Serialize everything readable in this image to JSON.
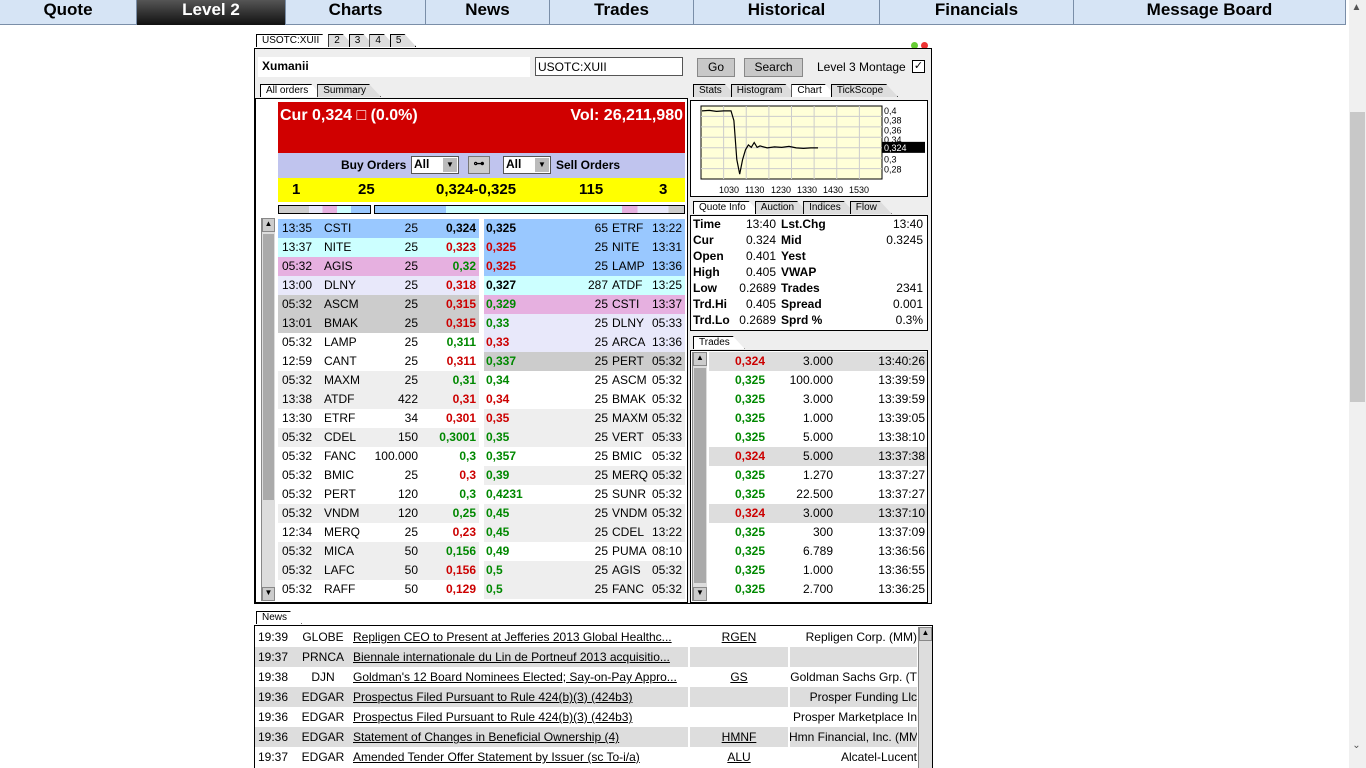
{
  "nav": [
    "Quote",
    "Level 2",
    "Charts",
    "News",
    "Trades",
    "Historical",
    "Financials",
    "Message Board"
  ],
  "nav_active": 1,
  "symbol_tabs": [
    "USOTC:XUII",
    "2",
    "3",
    "4",
    "5"
  ],
  "company": "Xumanii",
  "symbol_input": "USOTC:XUII",
  "go_label": "Go",
  "search_label": "Search",
  "montage_label": "Level 3 Montage",
  "montage_checked": true,
  "order_tabs": [
    "All orders",
    "Summary"
  ],
  "cur_text": "Cur 0,324 □ (0.0%)",
  "vol_text": "Vol: 26,211,980",
  "buy_label": "Buy Orders",
  "sell_label": "Sell Orders",
  "buy_filter": "All",
  "sell_filter": "All",
  "summary": {
    "bid_count": "1",
    "bid_size": "25",
    "spread": "0,324-0,325",
    "ask_size": "115",
    "ask_count": "3"
  },
  "bids": [
    [
      "13:35",
      "CSTI",
      "25",
      "0,324",
      "blk",
      "#99c8ff"
    ],
    [
      "13:37",
      "NITE",
      "25",
      "0,323",
      "red",
      "#ccffff"
    ],
    [
      "05:32",
      "AGIS",
      "25",
      "0,32",
      "grn",
      "#e6b0e0"
    ],
    [
      "13:00",
      "DLNY",
      "25",
      "0,318",
      "red",
      "#e8e8fa"
    ],
    [
      "05:32",
      "ASCM",
      "25",
      "0,315",
      "red",
      "#cccccc"
    ],
    [
      "13:01",
      "BMAK",
      "25",
      "0,315",
      "red",
      "#cccccc"
    ],
    [
      "05:32",
      "LAMP",
      "25",
      "0,311",
      "grn",
      "#ffffff"
    ],
    [
      "12:59",
      "CANT",
      "25",
      "0,311",
      "red",
      "#ffffff"
    ],
    [
      "05:32",
      "MAXM",
      "25",
      "0,31",
      "grn",
      "#eeeeee"
    ],
    [
      "13:38",
      "ATDF",
      "422",
      "0,31",
      "red",
      "#eeeeee"
    ],
    [
      "13:30",
      "ETRF",
      "34",
      "0,301",
      "red",
      "#ffffff"
    ],
    [
      "05:32",
      "CDEL",
      "150",
      "0,3001",
      "grn",
      "#eeeeee"
    ],
    [
      "05:32",
      "FANC",
      "100.000",
      "0,3",
      "grn",
      "#ffffff"
    ],
    [
      "05:32",
      "BMIC",
      "25",
      "0,3",
      "red",
      "#ffffff"
    ],
    [
      "05:32",
      "PERT",
      "120",
      "0,3",
      "grn",
      "#ffffff"
    ],
    [
      "05:32",
      "VNDM",
      "120",
      "0,25",
      "grn",
      "#eeeeee"
    ],
    [
      "12:34",
      "MERQ",
      "25",
      "0,23",
      "red",
      "#ffffff"
    ],
    [
      "05:32",
      "MICA",
      "50",
      "0,156",
      "grn",
      "#eeeeee"
    ],
    [
      "05:32",
      "LAFC",
      "50",
      "0,156",
      "red",
      "#eeeeee"
    ],
    [
      "05:32",
      "RAFF",
      "50",
      "0,129",
      "red",
      "#ffffff"
    ]
  ],
  "asks": [
    [
      "0,325",
      "65",
      "ETRF",
      "13:22",
      "blk",
      "#99c8ff"
    ],
    [
      "0,325",
      "25",
      "NITE",
      "13:31",
      "red",
      "#99c8ff"
    ],
    [
      "0,325",
      "25",
      "LAMP",
      "13:36",
      "red",
      "#99c8ff"
    ],
    [
      "0,327",
      "287",
      "ATDF",
      "13:25",
      "blk",
      "#ccffff"
    ],
    [
      "0,329",
      "25",
      "CSTI",
      "13:37",
      "grn",
      "#e6b0e0"
    ],
    [
      "0,33",
      "25",
      "DLNY",
      "05:33",
      "grn",
      "#e8e8fa"
    ],
    [
      "0,33",
      "25",
      "ARCA",
      "13:36",
      "red",
      "#e8e8fa"
    ],
    [
      "0,337",
      "25",
      "PERT",
      "05:32",
      "grn",
      "#cccccc"
    ],
    [
      "0,34",
      "25",
      "ASCM",
      "05:32",
      "grn",
      "#ffffff"
    ],
    [
      "0,34",
      "25",
      "BMAK",
      "05:32",
      "red",
      "#ffffff"
    ],
    [
      "0,35",
      "25",
      "MAXM",
      "05:32",
      "red",
      "#eeeeee"
    ],
    [
      "0,35",
      "25",
      "VERT",
      "05:33",
      "grn",
      "#eeeeee"
    ],
    [
      "0,357",
      "25",
      "BMIC",
      "05:32",
      "grn",
      "#ffffff"
    ],
    [
      "0,39",
      "25",
      "MERQ",
      "05:32",
      "grn",
      "#eeeeee"
    ],
    [
      "0,4231",
      "25",
      "SUNR",
      "05:32",
      "grn",
      "#ffffff"
    ],
    [
      "0,45",
      "25",
      "VNDM",
      "05:32",
      "grn",
      "#eeeeee"
    ],
    [
      "0,45",
      "25",
      "CDEL",
      "13:22",
      "grn",
      "#eeeeee"
    ],
    [
      "0,49",
      "25",
      "PUMA",
      "08:10",
      "grn",
      "#ffffff"
    ],
    [
      "0,5",
      "25",
      "AGIS",
      "05:32",
      "grn",
      "#eeeeee"
    ],
    [
      "0,5",
      "25",
      "FANC",
      "05:32",
      "grn",
      "#eeeeee"
    ]
  ],
  "right_tabs": [
    "Stats",
    "Histogram",
    "Chart",
    "TickScope"
  ],
  "chart_data": {
    "type": "line",
    "x_ticks": [
      "1030",
      "1130",
      "1230",
      "1330",
      "1430",
      "1530"
    ],
    "y_ticks": [
      "0,4",
      "0,38",
      "0,36",
      "0,34",
      "0,3",
      "0,28"
    ],
    "current_label": "0,324",
    "ylim": [
      0.26,
      0.41
    ],
    "x": [
      0,
      5,
      10,
      15,
      20,
      22,
      24,
      26,
      28,
      30,
      32,
      34,
      36,
      38,
      40,
      45,
      50,
      55,
      60,
      65,
      70,
      75,
      80
    ],
    "y": [
      0.4,
      0.401,
      0.399,
      0.4,
      0.4,
      0.38,
      0.3,
      0.27,
      0.3,
      0.32,
      0.33,
      0.325,
      0.335,
      0.325,
      0.328,
      0.324,
      0.326,
      0.325,
      0.327,
      0.324,
      0.323,
      0.324,
      0.324
    ]
  },
  "quote_tabs": [
    "Quote Info",
    "Auction",
    "Indices",
    "Flow"
  ],
  "quote": [
    [
      "Time",
      "13:40",
      "Lst.Chg",
      "13:40"
    ],
    [
      "Cur",
      "0.324",
      "Mid",
      "0.3245"
    ],
    [
      "Open",
      "0.401",
      "Yest",
      ""
    ],
    [
      "High",
      "0.405",
      "VWAP",
      ""
    ],
    [
      "Low",
      "0.2689",
      "Trades",
      "2341"
    ],
    [
      "Trd.Hi",
      "0.405",
      "Spread",
      "0.001"
    ],
    [
      "Trd.Lo",
      "0.2689",
      "Sprd %",
      "0.3%"
    ]
  ],
  "trades_tab": "Trades",
  "trades": [
    [
      "0,324",
      "3.000",
      "13:40:26",
      "red"
    ],
    [
      "0,325",
      "100.000",
      "13:39:59",
      "grn"
    ],
    [
      "0,325",
      "3.000",
      "13:39:59",
      "grn"
    ],
    [
      "0,325",
      "1.000",
      "13:39:05",
      "grn"
    ],
    [
      "0,325",
      "5.000",
      "13:38:10",
      "grn"
    ],
    [
      "0,324",
      "5.000",
      "13:37:38",
      "red"
    ],
    [
      "0,325",
      "1.270",
      "13:37:27",
      "grn"
    ],
    [
      "0,325",
      "22.500",
      "13:37:27",
      "grn"
    ],
    [
      "0,324",
      "3.000",
      "13:37:10",
      "red"
    ],
    [
      "0,325",
      "300",
      "13:37:09",
      "grn"
    ],
    [
      "0,325",
      "6.789",
      "13:36:56",
      "grn"
    ],
    [
      "0,325",
      "1.000",
      "13:36:55",
      "grn"
    ],
    [
      "0,325",
      "2.700",
      "13:36:25",
      "grn"
    ]
  ],
  "news_tab": "News",
  "news": [
    [
      "19:39",
      "GLOBE",
      "Repligen CEO to Present at Jefferies 2013 Global Healthc...",
      "RGEN",
      "Repligen Corp. (MM)"
    ],
    [
      "19:37",
      "PRNCA",
      "Biennale internationale du Lin de Portneuf 2013 acquisitio...",
      "",
      ""
    ],
    [
      "19:38",
      "DJN",
      "Goldman's 12 Board Nominees Elected; Say-on-Pay Appro...",
      "GS",
      "Goldman Sachs Grp. (T"
    ],
    [
      "19:36",
      "EDGAR",
      "Prospectus Filed Pursuant to Rule 424(b)(3) (424b3)",
      "",
      "Prosper Funding Llc"
    ],
    [
      "19:36",
      "EDGAR",
      "Prospectus Filed Pursuant to Rule 424(b)(3) (424b3)",
      "",
      "Prosper Marketplace In"
    ],
    [
      "19:36",
      "EDGAR",
      "Statement of Changes in Beneficial Ownership (4)",
      "HMNF",
      "Hmn Financial, Inc. (MM"
    ],
    [
      "19:37",
      "EDGAR",
      "Amended Tender Offer Statement by Issuer (sc To-i/a)",
      "ALU",
      "Alcatel-Lucent"
    ]
  ]
}
